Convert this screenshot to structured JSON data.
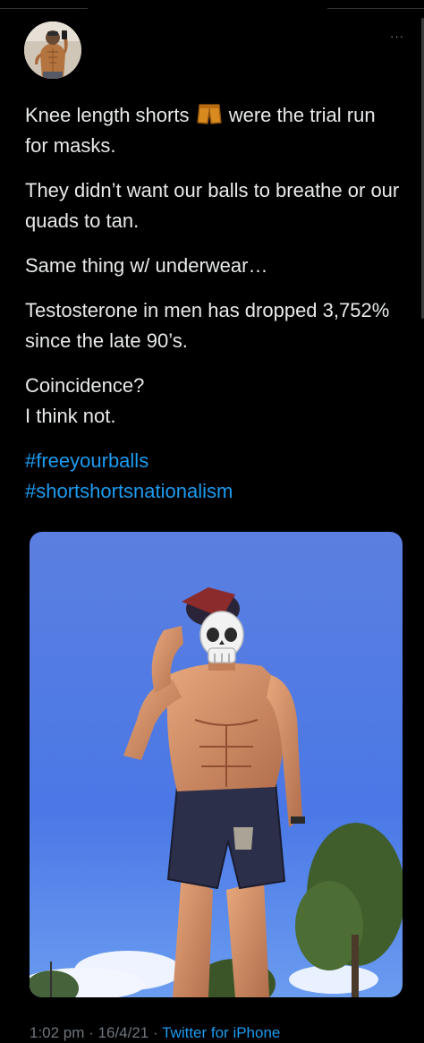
{
  "tweet": {
    "more_label": "···",
    "paragraphs": [
      {
        "before_emoji": "Knee length shorts",
        "emoji_name": "shorts-icon",
        "after_emoji": "were the trial run for masks."
      },
      {
        "text": "They didn’t want our balls to breathe or our quads to tan."
      },
      {
        "text": "Same thing w/ underwear…"
      },
      {
        "text": "Testosterone in men has dropped 3,752% since the late 90’s."
      },
      {
        "line1": "Coincidence?",
        "line2": "I think not."
      }
    ],
    "hashtags": [
      "#freeyourballs",
      "#shortshortsnationalism"
    ],
    "media": {
      "description_icon": "photo-icon",
      "overlay_emoji": "skull-icon"
    }
  },
  "meta": {
    "time": "1:02 pm",
    "separator1": " · ",
    "date": "16/4/21",
    "separator2": " · ",
    "source": "Twitter for iPhone"
  },
  "colors": {
    "background": "#000000",
    "text": "#e7e9ea",
    "link": "#1d9bf0",
    "secondary": "#6e767d"
  }
}
